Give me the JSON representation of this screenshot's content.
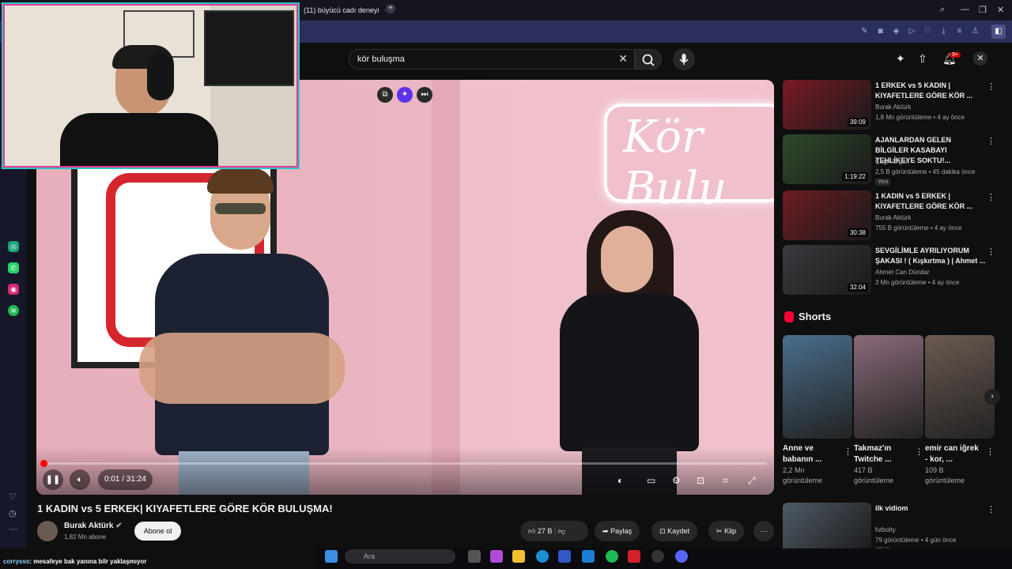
{
  "browser": {
    "tab_title": "(11) büyücü cadı deneyi",
    "tab_close": "·",
    "new_tab": "+"
  },
  "search": {
    "query": "kör buluşma",
    "clear": "✕"
  },
  "header": {
    "notifications_badge": "9+"
  },
  "video": {
    "neon_sign": "Kör Bulu",
    "time": "0:01 / 31:24",
    "progress_fraction": 0.0005
  },
  "title": "1 KADIN vs 5 ERKEK| KIYAFETLERE GÖRE KÖR BULUŞMA!",
  "channel": {
    "name": "Burak Aktürk",
    "subscribers": "1,82 Mn abone",
    "subscribe_label": "Abone ol"
  },
  "actions": {
    "likes": "27 B",
    "share": "Paylaş",
    "save": "Kaydet",
    "clip": "Klip",
    "more": "···"
  },
  "recommendations": [
    {
      "title": "1 ERKEK vs 5 KADIN | KIYAFETLERE GÖRE KÖR ...",
      "channel": "Burak Aktürk",
      "meta": "1,8 Mn görüntüleme • 4 ay önce",
      "duration": "39:09",
      "new": "",
      "color": "#7a1a24"
    },
    {
      "title": "AJANLARDAN GELEN BİLGİLER KASABAYI TEHLİKEYE SOKTU!...",
      "channel": "Çağrı Ergün",
      "meta": "2,5 B görüntüleme • 45 dakika önce",
      "duration": "1:19:22",
      "new": "Yeni",
      "color": "#2f4a2a"
    },
    {
      "title": "1 KADIN vs 5 ERKEK | KIYAFETLERE GÖRE KÖR ...",
      "channel": "Burak Aktürk",
      "meta": "755 B görüntüleme • 4 ay önce",
      "duration": "30:38",
      "new": "",
      "color": "#6e1c22"
    },
    {
      "title": "SEVGİLİMLE AYRILIYORUM ŞAKASI ! ( Kışkırtma ) | Ahmet ...",
      "channel": "Ahmet Can Dündar",
      "meta": "3 Mn görüntüleme • 4 ay önce",
      "duration": "32:04",
      "new": "",
      "color": "#3a3b3f"
    },
    {
      "title": "ilk vidiom",
      "channel": "futbolty",
      "meta": "79 görüntüleme • 4 gün önce",
      "duration": "",
      "new": "Yeni",
      "color": "#4f5a66"
    }
  ],
  "shorts": {
    "label": "Shorts",
    "items": [
      {
        "title": "Anne ve babanın ...",
        "views": "2,2 Mn görüntüleme",
        "color": "#4a6e8c"
      },
      {
        "title": "Takmaz'ın Twitche ...",
        "views": "417 B görüntüleme",
        "color": "#8a6a7a"
      },
      {
        "title": "emir can iğrek - kor, ...",
        "views": "109 B görüntüleme",
        "color": "#6b5a52"
      }
    ]
  },
  "chat": {
    "user": "corrysss",
    "message": ": mesafeye bak yanına bilr yaklaşmıyor"
  },
  "taskbar": {
    "search_placeholder": "Ara"
  },
  "icons": [
    "search-icon",
    "close-icon",
    "mic-icon",
    "upload-icon",
    "bell-icon",
    "pause-icon",
    "volume-icon",
    "settings-icon",
    "fullscreen-icon",
    "like-icon",
    "dislike-icon",
    "share-icon",
    "save-icon",
    "clip-icon",
    "more-icon"
  ]
}
